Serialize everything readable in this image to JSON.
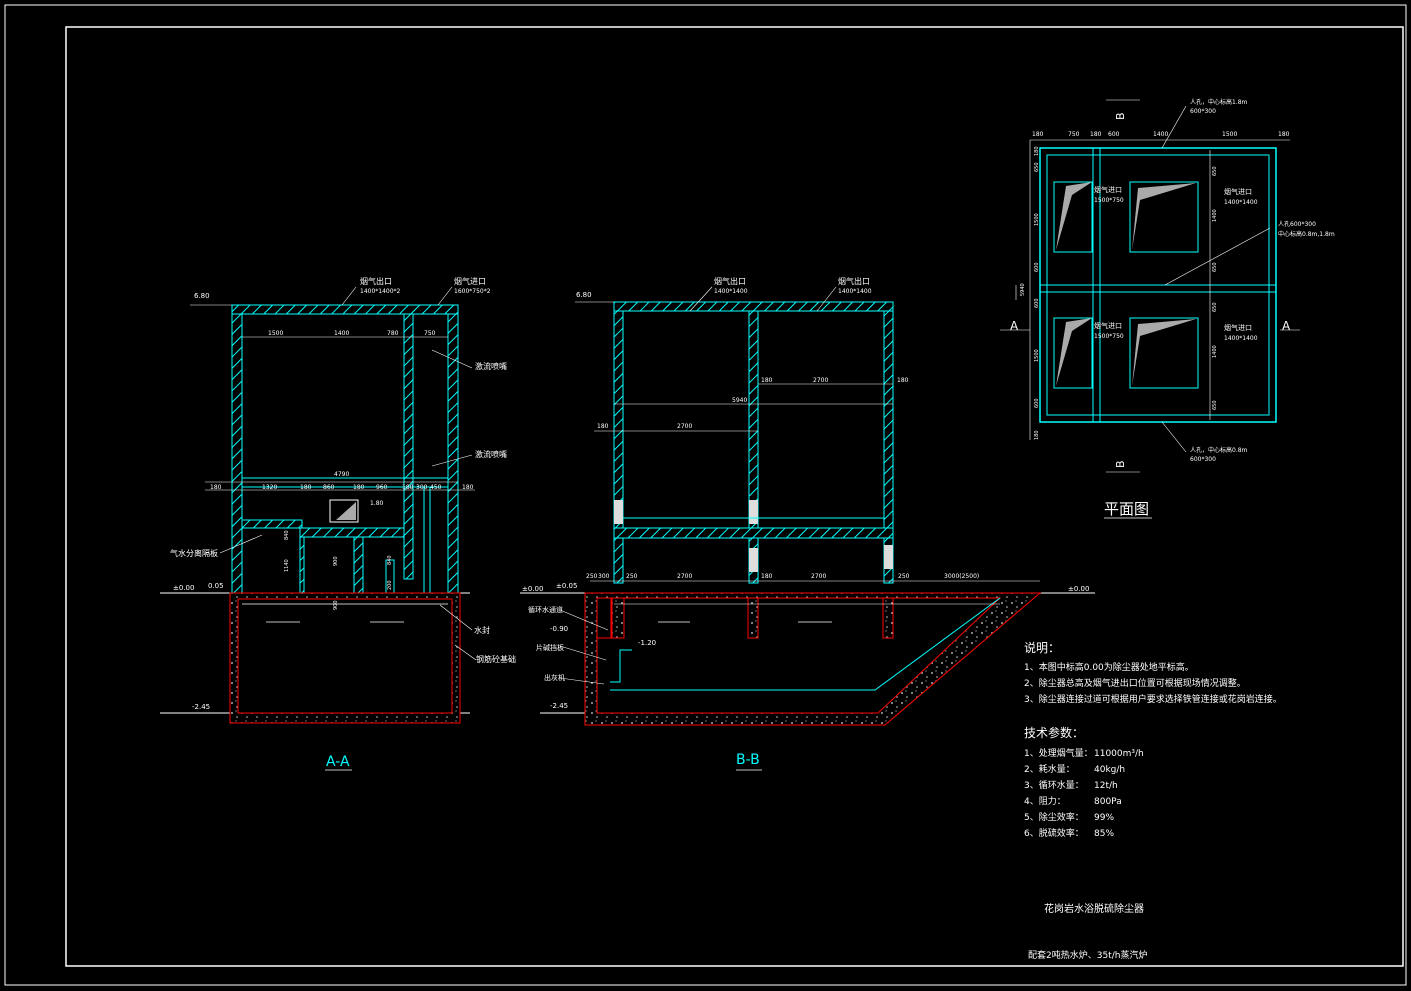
{
  "section_aa": {
    "title": "A-A",
    "labels": {
      "outlet": "烟气出口",
      "outlet_size": "1400*1400*2",
      "inlet": "烟气进口",
      "inlet_size": "1600*750*2",
      "elev_top": "6.80",
      "elev_zero": "±0.00",
      "elev_005": "0.05",
      "elev_180": "1.80",
      "elev_bottom": "-2.45",
      "turbulence_1": "激流喷嘴",
      "turbulence_2": "激流喷嘴",
      "separator": "气水分离隔板",
      "water_seal": "水封",
      "concrete": "钢筋砼基础"
    },
    "dims_top": [
      "1500",
      "1400",
      "780",
      "750"
    ],
    "dim_total": "4790",
    "dims_mid": [
      "180",
      "1320",
      "180",
      "860",
      "180",
      "960",
      "180",
      "300",
      "450",
      "180"
    ],
    "dims_vertical": [
      "840",
      "1140",
      "900",
      "900",
      "840",
      "200"
    ]
  },
  "section_bb": {
    "title": "B-B",
    "labels": {
      "outlet_1": "烟气出口",
      "outlet_1_size": "1400*1400",
      "outlet_2": "烟气出口",
      "outlet_2_size": "1400*1400",
      "elev_top": "6.80",
      "elev_zero": "±0.00",
      "elev_005": "±0.05",
      "elev_right": "±0.00",
      "elev_m090": "-0.90",
      "elev_m120": "-1.20",
      "elev_bottom": "-2.45",
      "circ_channel": "循环水通道",
      "baffle": "片碱挡板",
      "ash_machine": "出灰机"
    },
    "dims_upper": [
      "180",
      "2700",
      "180"
    ],
    "dim_total": "5940",
    "dims_lower": [
      "180",
      "2700"
    ],
    "dims_bottom": [
      "250",
      "300",
      "250",
      "2700",
      "180",
      "2700",
      "250",
      "3000(2500)"
    ]
  },
  "plan": {
    "title": "平面图",
    "section_marks": [
      "B",
      "B",
      "A",
      "A"
    ],
    "dims_top": [
      "180",
      "750",
      "180",
      "600",
      "1400",
      "1500",
      "180"
    ],
    "dims_left": [
      "180",
      "650",
      "1500",
      "600",
      "600",
      "1500",
      "600",
      "180"
    ],
    "dims_right": [
      "650",
      "1400",
      "650",
      "650",
      "1400",
      "650"
    ],
    "dim_side": "5940",
    "labels": {
      "manhole_top": "人孔，中心标高1.8m",
      "manhole_top_size": "600*300",
      "inlet_a": "烟气进口",
      "inlet_a_size": "1500*750",
      "inlet_b": "烟气进口",
      "inlet_b_size": "1400*1400",
      "manhole_mid": "人孔600*300",
      "manhole_mid_elev": "中心标高0.8m,1.8m",
      "inlet_c": "烟气进口",
      "inlet_c_size": "1500*750",
      "inlet_d": "烟气进口",
      "inlet_d_size": "1400*1400",
      "manhole_bottom": "人孔，中心标高0.8m",
      "manhole_bottom_size": "600*300"
    }
  },
  "notes": {
    "heading": "说明：",
    "items": [
      "1、本图中标高0.00为除尘器处地平标高。",
      "2、除尘器总高及烟气进出口位置可根据现场情况调整。",
      "3、除尘器连接过道可根据用户要求选择铁管连接或花岗岩连接。"
    ]
  },
  "tech": {
    "heading": "技术参数：",
    "items": [
      {
        "label": "1、处理烟气量：",
        "value": "11000m³/h"
      },
      {
        "label": "2、耗水量：",
        "value": "40kg/h"
      },
      {
        "label": "3、循环水量：",
        "value": "12t/h"
      },
      {
        "label": "4、阻力：",
        "value": "800Pa"
      },
      {
        "label": "5、除尘效率：",
        "value": "99%"
      },
      {
        "label": "6、脱硫效率：",
        "value": "85%"
      }
    ]
  },
  "title_block": {
    "name": "花岗岩水浴脱硫除尘器",
    "subtitle": "配套2吨热水炉、35t/h蒸汽炉"
  },
  "colors": {
    "background": "#000000",
    "structure": "#00ffff",
    "foundation": "#ff0000",
    "text": "#ffffff",
    "fill": "#aaaaaa"
  }
}
